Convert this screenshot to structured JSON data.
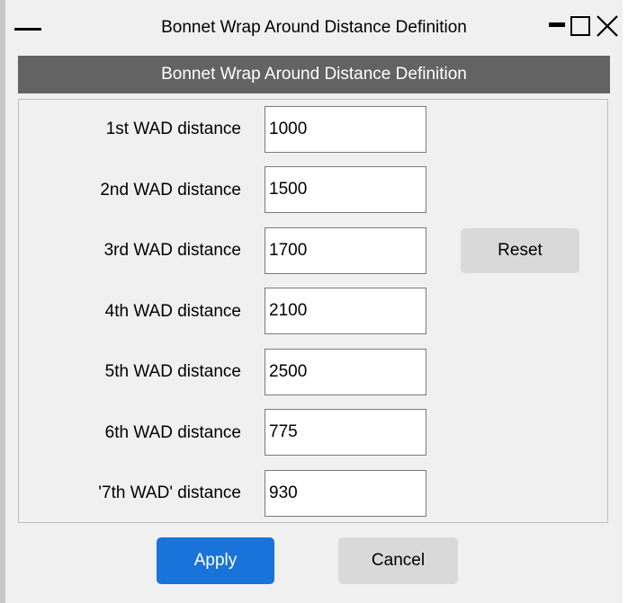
{
  "window": {
    "title": "Bonnet Wrap Around Distance Definition"
  },
  "header": {
    "title": "Bonnet Wrap Around Distance Definition"
  },
  "fields": [
    {
      "label": "1st WAD distance",
      "value": "1000"
    },
    {
      "label": "2nd WAD distance",
      "value": "1500"
    },
    {
      "label": "3rd WAD distance",
      "value": "1700"
    },
    {
      "label": "4th WAD distance",
      "value": "2100"
    },
    {
      "label": "5th WAD distance",
      "value": "2500"
    },
    {
      "label": "6th WAD distance",
      "value": "775"
    },
    {
      "label": "'7th WAD' distance",
      "value": "930"
    }
  ],
  "buttons": {
    "reset": "Reset",
    "apply": "Apply",
    "cancel": "Cancel"
  },
  "icons": {
    "menu": "menu-bar-icon",
    "minimize": "minimize-icon",
    "maximize": "maximize-icon",
    "close": "close-icon"
  },
  "colors": {
    "header_bar": "#636363",
    "apply_button": "#1a73d9",
    "neutral_button": "#d9d9d9",
    "background": "#f0f0f0"
  }
}
